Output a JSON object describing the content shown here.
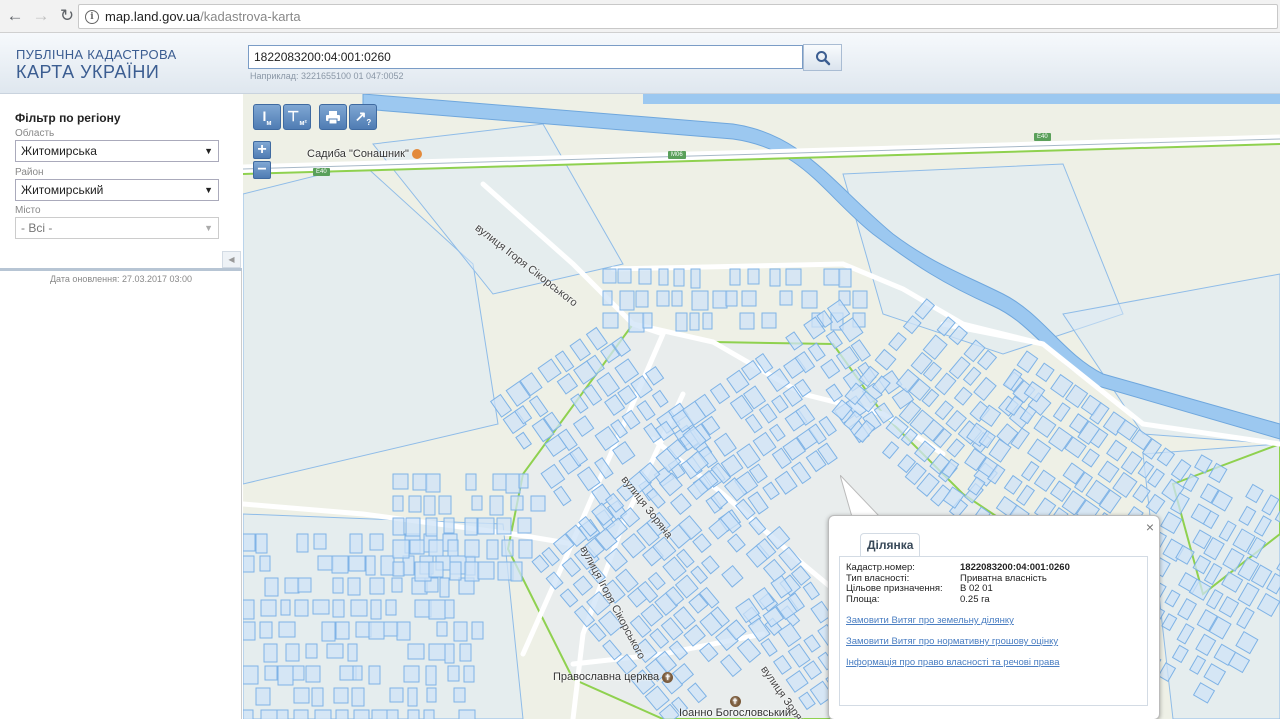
{
  "browser": {
    "back_icon": "arrow-left-icon",
    "forward_icon": "arrow-right-icon",
    "reload_icon": "reload-icon",
    "url_host": "map.land.gov.ua",
    "url_path": "/kadastrova-karta"
  },
  "header": {
    "logo_line1": "ПУБЛІЧНА КАДАСТРОВА",
    "logo_line2": "КАРТА УКРАЇНИ",
    "search_value": "1822083200:04:001:0260",
    "search_hint": "Наприклад: 3221655100 01 047:0052",
    "search_icon": "magnifier-icon"
  },
  "sidebar": {
    "title": "Фільтр по регіону",
    "oblast_label": "Область",
    "oblast_value": "Житомирська",
    "raion_label": "Район",
    "raion_value": "Житомирський",
    "misto_label": "Місто",
    "misto_value": "- Всі -",
    "collapse_icon": "triangle-left-icon",
    "update_date": "Дата оновлення: 27.03.2017 03:00"
  },
  "map": {
    "tools": [
      {
        "name": "measure-length-tool",
        "icon": "ruler-icon",
        "label": "М"
      },
      {
        "name": "measure-area-tool",
        "icon": "area-ruler-icon",
        "label": "М²"
      },
      {
        "name": "print-tool",
        "icon": "printer-icon",
        "label": ""
      },
      {
        "name": "identify-tool",
        "icon": "pointer-question-icon",
        "label": "?"
      }
    ],
    "zoom_in": "+",
    "zoom_out": "−",
    "labels": {
      "sadyba": "Садиба \"Сонашник\"",
      "street1": "вулиця Ігоря Сікорського",
      "street2": "вулиця Зоряна",
      "street3": "вулиця Ігоря Сікорського",
      "street4": "вулиця Зоряна",
      "church1": "Православна церква",
      "church2": "Іоанно Богословський"
    },
    "road_shields": [
      "E40",
      "M06",
      "E40"
    ],
    "colors": {
      "water": "#9cc8f0",
      "parcel_fill": "#cfe3f7",
      "parcel_stroke": "#7fb3e6",
      "boundary": "#8fd14f",
      "background": "#eef0e6"
    }
  },
  "popup": {
    "tab": "Ділянка",
    "rows": [
      {
        "key": "Кадастр.номер:",
        "value": "1822083200:04:001:0260"
      },
      {
        "key": "Тип власності:",
        "value": "Приватна власність"
      },
      {
        "key": "Цільове призначення:",
        "value": "В 02 01"
      },
      {
        "key": "Площа:",
        "value": "0.25 га"
      }
    ],
    "link1": "Замовити Витяг про земельну ділянку",
    "link2": "Замовити Витяг про нормативну грошову оцінку",
    "link3": "Інформація про право власності та речові права",
    "close": "×"
  }
}
